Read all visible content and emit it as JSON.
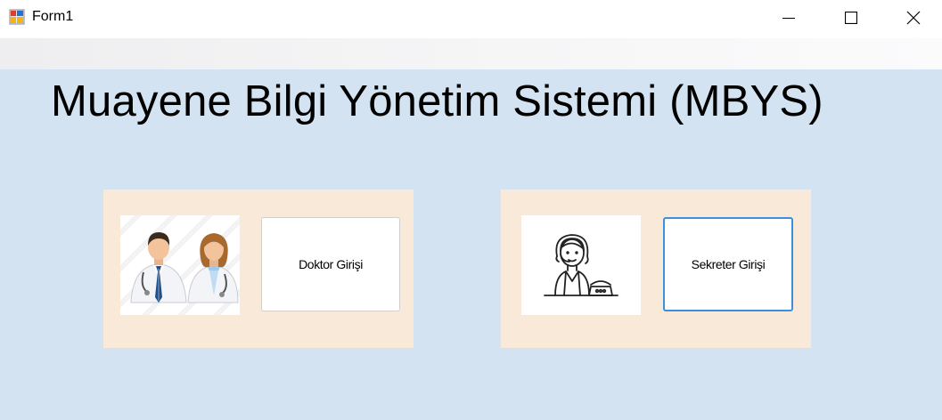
{
  "window": {
    "title": "Form1",
    "icon": "winforms-app-icon",
    "controls": [
      "minimize-icon",
      "maximize-icon",
      "close-icon"
    ]
  },
  "main": {
    "heading": "Muayene Bilgi Yönetim Sistemi (MBYS)",
    "panels": [
      {
        "image": "doctors-illustration",
        "button_label": "Doktor Girişi"
      },
      {
        "image": "secretary-illustration",
        "button_label": "Sekreter Girişi"
      }
    ]
  },
  "colors": {
    "client_background": "#d4e3f1",
    "panel_background": "#f9e9d8",
    "focus_border": "#3c8fdb"
  }
}
